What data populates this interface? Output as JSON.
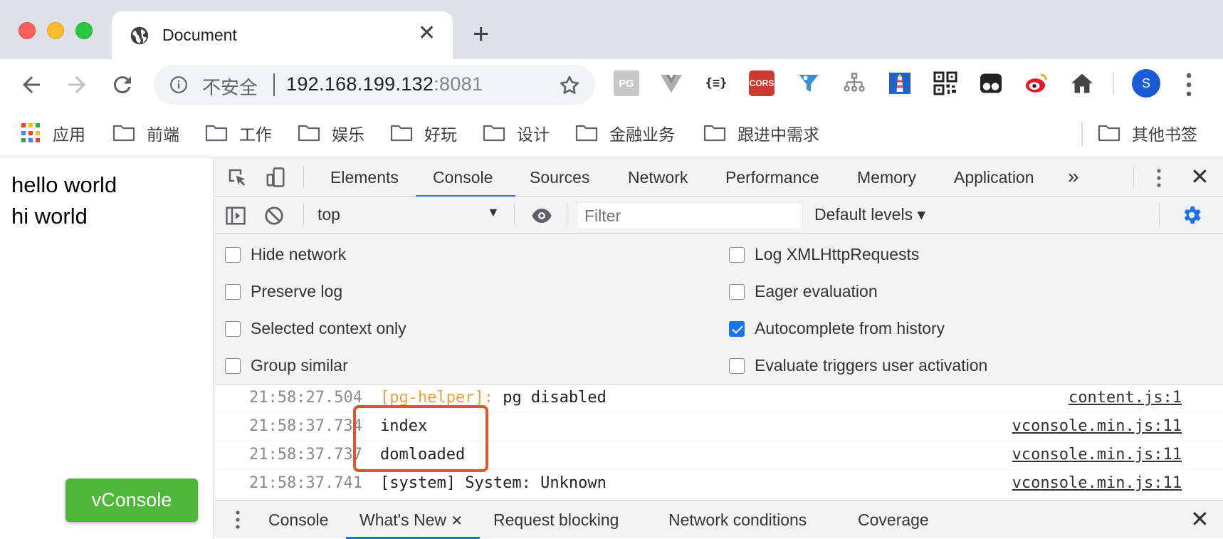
{
  "browser": {
    "tab": {
      "title": "Document",
      "close_glyph": "✕"
    },
    "new_tab_glyph": "+",
    "address": {
      "security_label": "不安全",
      "host": "192.168.199.132",
      "port": ":8081"
    },
    "extensions": [
      {
        "icon": "pg-helper-icon",
        "label": "PG"
      },
      {
        "icon": "vue-devtools-icon",
        "label": ""
      },
      {
        "icon": "json-formatter-icon",
        "label": "{≡}"
      },
      {
        "icon": "cors-icon",
        "label": "CORS"
      },
      {
        "icon": "funnel-extension-icon",
        "label": ""
      },
      {
        "icon": "sitemap-icon",
        "label": ""
      },
      {
        "icon": "lighthouse-icon",
        "label": ""
      },
      {
        "icon": "qr-code-icon",
        "label": ""
      },
      {
        "icon": "tampermonkey-icon",
        "label": ""
      },
      {
        "icon": "weibo-icon",
        "label": ""
      },
      {
        "icon": "home-icon",
        "label": ""
      }
    ],
    "profile_initial": "S",
    "bookmarks": {
      "apps_label": "应用",
      "folders": [
        "前端",
        "工作",
        "娱乐",
        "好玩",
        "设计",
        "金融业务",
        "跟进中需求"
      ],
      "other": "其他书签"
    }
  },
  "page": {
    "lines": [
      "hello world",
      "hi world"
    ],
    "vconsole_label": "vConsole"
  },
  "devtools": {
    "tabs": [
      "Elements",
      "Console",
      "Sources",
      "Network",
      "Performance",
      "Memory",
      "Application"
    ],
    "active_tab": "Console",
    "more_glyph": "»",
    "close_glyph": "✕",
    "console_toolbar": {
      "context": "top",
      "filter_placeholder": "Filter",
      "levels": "Default levels ▾"
    },
    "settings": {
      "left": [
        {
          "label": "Hide network",
          "checked": false
        },
        {
          "label": "Preserve log",
          "checked": false
        },
        {
          "label": "Selected context only",
          "checked": false
        },
        {
          "label": "Group similar",
          "checked": false
        }
      ],
      "right": [
        {
          "label": "Log XMLHttpRequests",
          "checked": false
        },
        {
          "label": "Eager evaluation",
          "checked": false
        },
        {
          "label": "Autocomplete from history",
          "checked": true
        },
        {
          "label": "Evaluate triggers user activation",
          "checked": false
        }
      ]
    },
    "messages": [
      {
        "time": "21:58:27.504",
        "tag": "[pg-helper]:",
        "text": " pg disabled",
        "source": "content.js:1"
      },
      {
        "time": "21:58:37.734",
        "tag": "",
        "text": "index",
        "source": "vconsole.min.js:11"
      },
      {
        "time": "21:58:37.737",
        "tag": "",
        "text": "domloaded",
        "source": "vconsole.min.js:11"
      },
      {
        "time": "21:58:37.741",
        "tag": "",
        "text": "[system] System: Unknown",
        "source": "vconsole.min.js:11"
      }
    ],
    "drawer": {
      "tabs": [
        "Console",
        "What's New",
        "Request blocking",
        "Network conditions",
        "Coverage"
      ],
      "active_tab": "What's New",
      "tab_close_glyph": "✕",
      "close_glyph": "✕"
    }
  },
  "colors": {
    "accent": "#1a73e8",
    "vconsole_green": "#4fb73b",
    "highlight": "#e8512a",
    "tag_orange": "#e8a33d"
  }
}
